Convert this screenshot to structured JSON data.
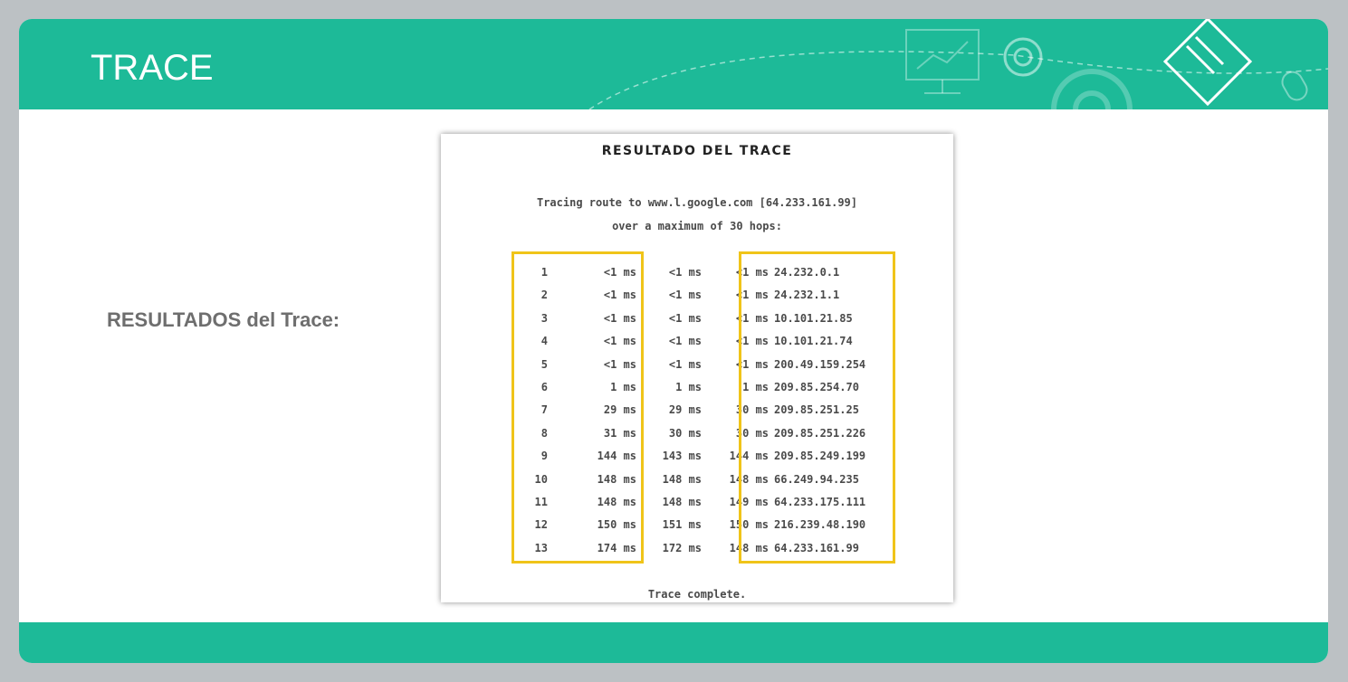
{
  "header": {
    "title": "TRACE"
  },
  "side_label": "RESULTADOS del Trace:",
  "trace_panel": {
    "title": "RESULTADO DEL TRACE",
    "route_line": "Tracing route to www.l.google.com [64.233.161.99]",
    "hops_line": "over a maximum of 30 hops:",
    "hops": [
      {
        "num": "1",
        "t1": "<1 ms",
        "t2": "<1 ms",
        "t3": "<1 ms",
        "ip": "24.232.0.1"
      },
      {
        "num": "2",
        "t1": "<1 ms",
        "t2": "<1 ms",
        "t3": "<1 ms",
        "ip": "24.232.1.1"
      },
      {
        "num": "3",
        "t1": "<1 ms",
        "t2": "<1 ms",
        "t3": "<1 ms",
        "ip": "10.101.21.85"
      },
      {
        "num": "4",
        "t1": "<1 ms",
        "t2": "<1 ms",
        "t3": "<1 ms",
        "ip": "10.101.21.74"
      },
      {
        "num": "5",
        "t1": "<1 ms",
        "t2": "<1 ms",
        "t3": "<1 ms",
        "ip": "200.49.159.254"
      },
      {
        "num": "6",
        "t1": "1 ms",
        "t2": "1 ms",
        "t3": "1 ms",
        "ip": "209.85.254.70"
      },
      {
        "num": "7",
        "t1": "29 ms",
        "t2": "29 ms",
        "t3": "30 ms",
        "ip": "209.85.251.25"
      },
      {
        "num": "8",
        "t1": "31 ms",
        "t2": "30 ms",
        "t3": "30 ms",
        "ip": "209.85.251.226"
      },
      {
        "num": "9",
        "t1": "144 ms",
        "t2": "143 ms",
        "t3": "144 ms",
        "ip": "209.85.249.199"
      },
      {
        "num": "10",
        "t1": "148 ms",
        "t2": "148 ms",
        "t3": "148 ms",
        "ip": "66.249.94.235"
      },
      {
        "num": "11",
        "t1": "148 ms",
        "t2": "148 ms",
        "t3": "149 ms",
        "ip": "64.233.175.111"
      },
      {
        "num": "12",
        "t1": "150 ms",
        "t2": "151 ms",
        "t3": "150 ms",
        "ip": "216.239.48.190"
      },
      {
        "num": "13",
        "t1": "174 ms",
        "t2": "172 ms",
        "t3": "148 ms",
        "ip": "64.233.161.99"
      }
    ],
    "complete_line": "Trace complete."
  },
  "colors": {
    "brand": "#1dba98",
    "highlight": "#f0c419",
    "background": "#bcc1c4"
  },
  "icons": [
    "presentation-board-icon",
    "gear-icon",
    "pencil-puzzle-icon",
    "mouse-icon"
  ]
}
